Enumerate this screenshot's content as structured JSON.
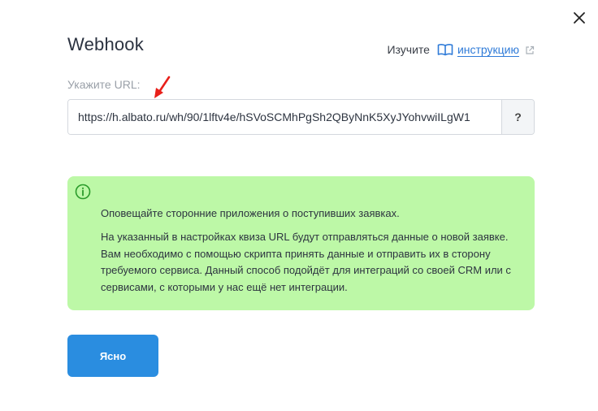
{
  "dialog": {
    "title": "Webhook",
    "close_icon": "close-icon"
  },
  "help": {
    "prefix": "Изучите",
    "link_text": "инструкцию",
    "book_icon": "book-icon",
    "external_icon": "external-link-icon",
    "link_color": "#2f7bd8"
  },
  "url": {
    "label": "Укажите URL:",
    "value": "https://h.albato.ru/wh/90/1lftv4e/hSVoSCMhPgSh2QByNnK5XyJYohvwiILgW1",
    "help_button": "?"
  },
  "annotation": {
    "arrow_color": "#e8201a"
  },
  "info": {
    "icon": "info-circle-icon",
    "background": "#bdf8a7",
    "line1": "Оповещайте сторонние приложения о поступивших заявках.",
    "paragraph": "На указанный в настройках квиза URL будут отправляться данные о новой заявке. Вам необходимо с помощью скрипта принять данные и отправить их в сторону требуемого сервиса. Данный способ подойдёт для интеграций со своей CRM или с сервисами, с которыми у нас ещё нет интеграции."
  },
  "actions": {
    "ok_label": "Ясно",
    "ok_color": "#2a8de0"
  }
}
